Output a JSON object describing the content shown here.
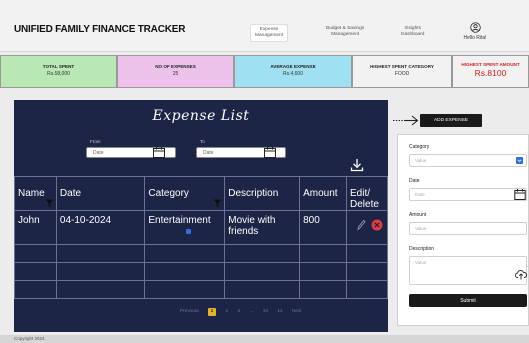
{
  "header": {
    "title": "UNIFIED FAMILY FINANCE TRACKER",
    "nav": [
      {
        "label": "Expense\nManagement"
      },
      {
        "label": "Budget & Savings\nManagement"
      },
      {
        "label": "Insights\nDashboard"
      }
    ],
    "greeting": "Hello Rita!"
  },
  "stats": [
    {
      "label": "TOTAL SPENT",
      "value": "Rs.58,000",
      "color": "#b9e8b4"
    },
    {
      "label": "NO OF EXPENSES",
      "value": "25",
      "color": "#ecc2ea"
    },
    {
      "label": "AVERAGE EXPENSE",
      "value": "Rs.4,600",
      "color": "#9fe0f2"
    },
    {
      "label": "HIGHEST SPENT CATEGORY",
      "value": "FOOD",
      "color": "#f2f2f2"
    },
    {
      "label": "HIGHEST SPENT AMOUNT",
      "value": "Rs.8100",
      "color": "#f2f2f2"
    }
  ],
  "expense_list": {
    "title": "Expense List",
    "from_label": "From",
    "to_label": "To",
    "from_placeholder": "Date",
    "to_placeholder": "Date",
    "columns": [
      "Name",
      "Date",
      "Category",
      "Description",
      "Amount",
      "Edit/\nDelete"
    ],
    "rows": [
      {
        "name": "John",
        "date": "04-10-2024",
        "category": "Entertainment",
        "description": "Movie   with friends",
        "amount": "800"
      }
    ],
    "pagination": {
      "previous": "Previous",
      "current": "1",
      "pages": [
        "2",
        "3",
        "...",
        "10",
        "11"
      ],
      "next": "Next"
    }
  },
  "form": {
    "add_button": "ADD EXPENSE",
    "category_label": "Category",
    "category_placeholder": "Value",
    "date_label": "Date",
    "date_placeholder": "Date",
    "amount_label": "Amount",
    "amount_placeholder": "Value",
    "description_label": "Description",
    "description_placeholder": "Value",
    "submit": "Submit"
  },
  "footer": {
    "text": "Copyright 2024"
  },
  "colors": {
    "panel": "#1d2547",
    "accent_red": "#d32020",
    "chip_blue": "#2f6fe0",
    "page_active": "#e2b32a"
  }
}
